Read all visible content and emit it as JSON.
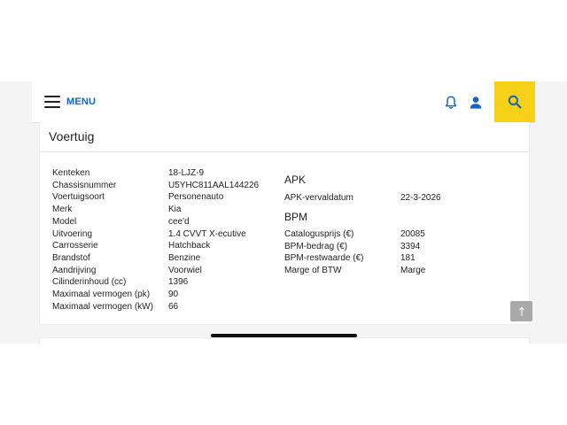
{
  "header": {
    "menu_label": "MENU",
    "icons": [
      "hamburger-icon",
      "bell-icon",
      "user-icon",
      "search-icon"
    ],
    "accent_color": "#1565c0",
    "search_bg": "#f7d117"
  },
  "section": {
    "title": "Voertuig"
  },
  "vehicle": [
    {
      "label": "Kenteken",
      "value": "18-LJZ-9"
    },
    {
      "label": "Chassisnummer",
      "value": "U5YHC811AAL144226"
    },
    {
      "label": "Voertuigsoort",
      "value": "Personenauto"
    },
    {
      "label": "Merk",
      "value": "Kia"
    },
    {
      "label": "Model",
      "value": "cee'd"
    },
    {
      "label": "Uitvoering",
      "value": "1.4 CVVT X-ecutive"
    },
    {
      "label": "Carrosserie",
      "value": "Hatchback"
    },
    {
      "label": "Brandstof",
      "value": "Benzine"
    },
    {
      "label": "Aandrijving",
      "value": "Voorwiel"
    },
    {
      "label": "Cilinderinhoud (cc)",
      "value": "1396"
    },
    {
      "label": "Maximaal vermogen (pk)",
      "value": "90"
    },
    {
      "label": "Maximaal vermogen (kW)",
      "value": "66"
    }
  ],
  "apk": {
    "heading": "APK",
    "rows": [
      {
        "label": "APK-vervaldatum",
        "value": "22-3-2026"
      }
    ]
  },
  "bpm": {
    "heading": "BPM",
    "rows": [
      {
        "label": "Catalogusprijs (€)",
        "value": "20085"
      },
      {
        "label": "BPM-bedrag (€)",
        "value": "3394"
      },
      {
        "label": "BPM-restwaarde (€)",
        "value": "181"
      },
      {
        "label": "Marge of BTW",
        "value": "Marge"
      }
    ]
  },
  "scroll_top_icon": "arrow-up-icon"
}
